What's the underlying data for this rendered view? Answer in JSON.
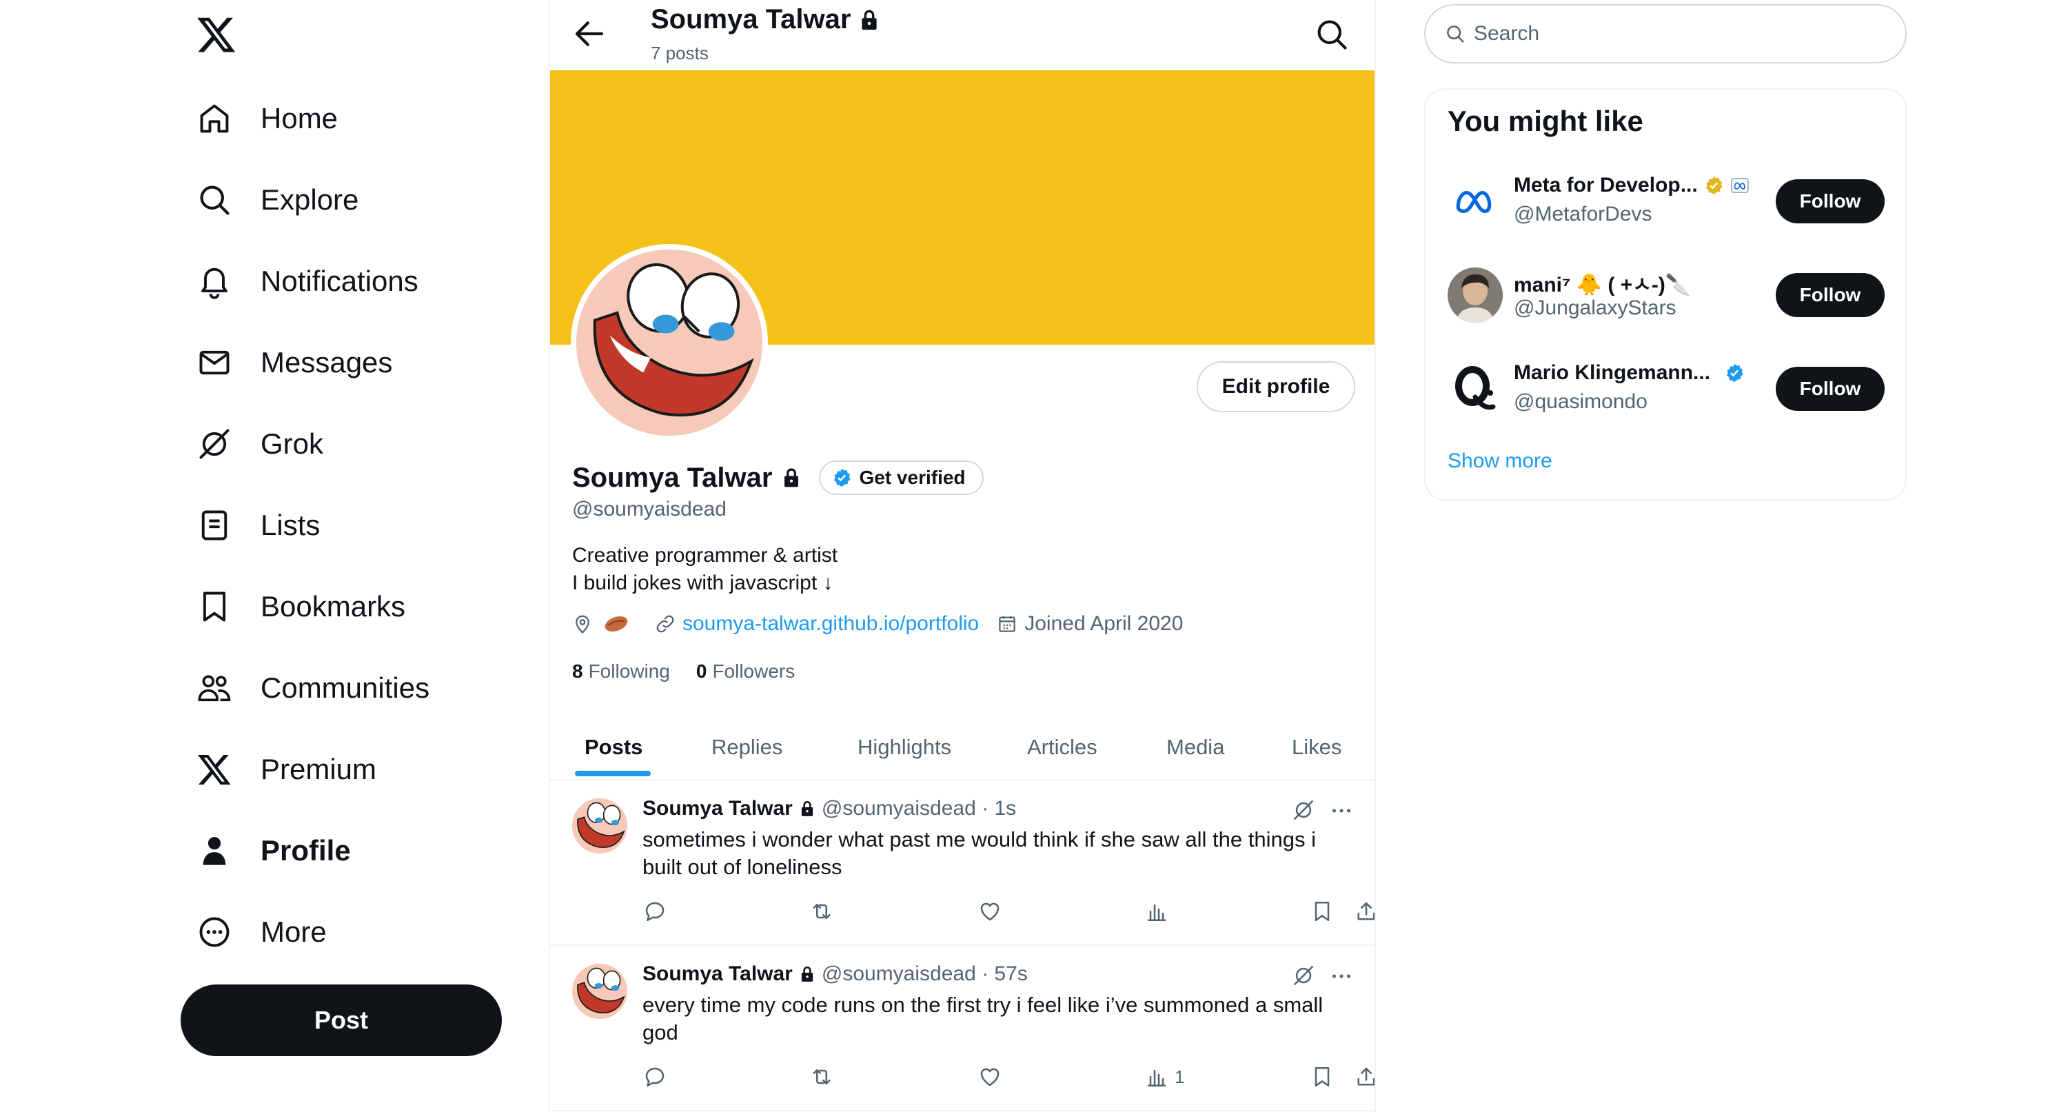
{
  "nav": {
    "items": [
      {
        "label": "Home",
        "icon": "home-icon"
      },
      {
        "label": "Explore",
        "icon": "search-icon"
      },
      {
        "label": "Notifications",
        "icon": "bell-icon"
      },
      {
        "label": "Messages",
        "icon": "envelope-icon"
      },
      {
        "label": "Grok",
        "icon": "grok-icon"
      },
      {
        "label": "Lists",
        "icon": "list-icon"
      },
      {
        "label": "Bookmarks",
        "icon": "bookmark-icon"
      },
      {
        "label": "Communities",
        "icon": "people-icon"
      },
      {
        "label": "Premium",
        "icon": "x-logo-icon"
      },
      {
        "label": "Profile",
        "icon": "person-icon"
      },
      {
        "label": "More",
        "icon": "more-circle-icon"
      }
    ],
    "active": "Profile",
    "post_label": "Post"
  },
  "header": {
    "name": "Soumya Talwar",
    "posts_count": "7 posts"
  },
  "profile": {
    "name": "Soumya Talwar",
    "get_verified": "Get verified",
    "handle": "@soumyaisdead",
    "bio_line1": "Creative programmer & artist",
    "bio_line2": "I build jokes with javascript ↓",
    "website": "soumya-talwar.github.io/portfolio",
    "joined": "Joined April 2020",
    "following_count": "8",
    "following_label": "Following",
    "followers_count": "0",
    "followers_label": "Followers",
    "edit_profile": "Edit profile",
    "banner_color": "#f4c119"
  },
  "tabs": [
    "Posts",
    "Replies",
    "Highlights",
    "Articles",
    "Media",
    "Likes"
  ],
  "tweets": [
    {
      "name": "Soumya Talwar",
      "meta": "@soumyaisdead · 1s",
      "text": "sometimes i wonder what past me would think if she saw all the things i built out of loneliness",
      "views": ""
    },
    {
      "name": "Soumya Talwar",
      "meta": "@soumyaisdead · 57s",
      "text": "every time my code runs on the first try i feel like i’ve summoned a small god",
      "views": "1"
    }
  ],
  "sidebar": {
    "search_placeholder": "Search",
    "wtf_title": "You might like",
    "suggestions": [
      {
        "name": "Meta for Develop...",
        "handle": "@MetaforDevs",
        "badge": "gold-check"
      },
      {
        "name": "mani⁷ 🐥 ( +ㅅ-)🔪",
        "handle": "@JungalaxyStars",
        "badge": ""
      },
      {
        "name": "Mario Klingemann...",
        "handle": "@quasimondo",
        "badge": "blue-check"
      }
    ],
    "follow_label": "Follow",
    "show_more": "Show more"
  },
  "colors": {
    "accent": "#1d9bf0",
    "text": "#0f1419",
    "muted": "#536471",
    "gold": "#e2b719"
  }
}
